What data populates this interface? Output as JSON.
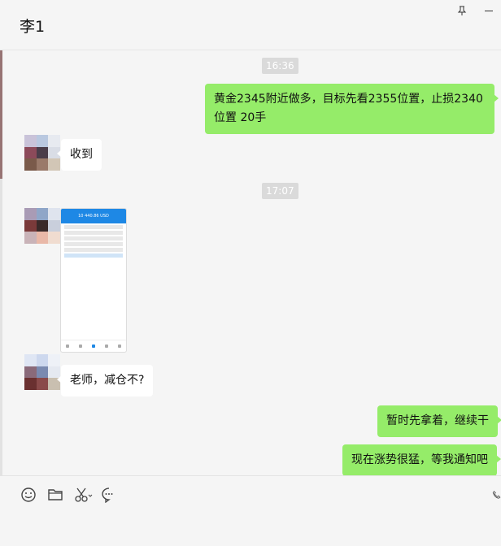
{
  "chat": {
    "title": "李1"
  },
  "window": {
    "pin_glyph": "⊼"
  },
  "messages": {
    "ts1": "16:36",
    "m1": "黄金2345附近做多，目标先看2355位置，止损2340位置  20手",
    "m2": "收到",
    "ts2": "17:07",
    "phone_header": "10 440.86 USD",
    "m4": "老师，减仓不?",
    "m5": "暂时先拿着，继续干",
    "m6": "现在涨势很猛，等我通知吧"
  },
  "colors": {
    "sent_bubble": "#95ec69",
    "received_bubble": "#ffffff",
    "background": "#f5f5f5"
  },
  "toolbar": {
    "icons": [
      "emoji-icon",
      "folder-icon",
      "scissors-icon",
      "chat-bubble-icon",
      "phone-icon"
    ]
  }
}
